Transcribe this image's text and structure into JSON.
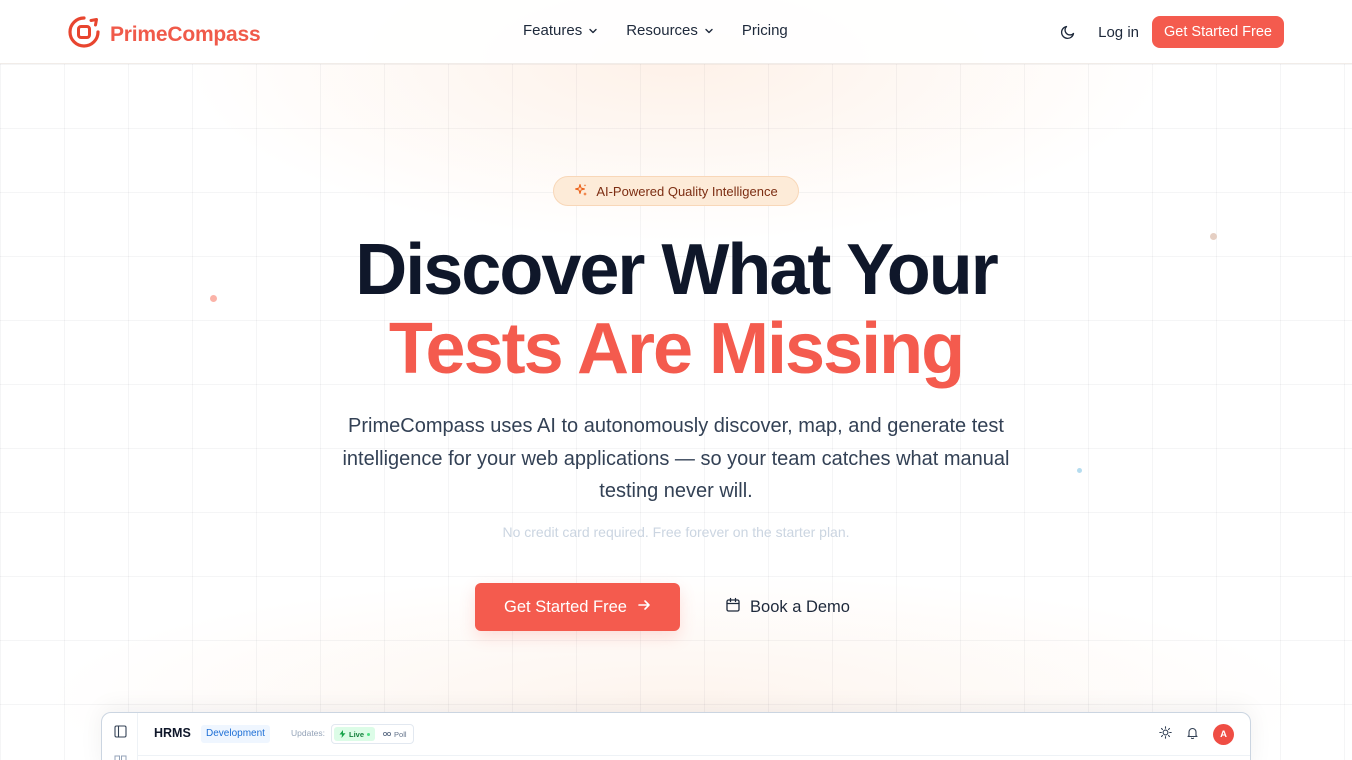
{
  "brand": {
    "name": "PrimeCompass",
    "color": "#f45b4e"
  },
  "nav": {
    "items": [
      {
        "label": "Features",
        "has_dropdown": true
      },
      {
        "label": "Resources",
        "has_dropdown": true
      },
      {
        "label": "Pricing",
        "has_dropdown": false
      }
    ],
    "theme_icon": "moon-icon",
    "login_label": "Log in",
    "cta_label": "Get Started Free"
  },
  "hero": {
    "badge": "AI-Powered Quality Intelligence",
    "headline_line1": "Discover What Your",
    "headline_line2": "Tests Are Missing",
    "subtext": "PrimeCompass uses AI to autonomously discover, map, and generate test intelligence for your web applications — so your team catches what manual testing never will.",
    "note": "No credit card required. Free forever on the starter plan.",
    "primary_cta": "Get Started Free",
    "secondary_cta": "Book a Demo"
  },
  "preview": {
    "app_name": "HRMS",
    "environment": "Development",
    "updates_label": "Updates:",
    "live_label": "Live",
    "poll_label": "Poll",
    "avatar_initial": "A"
  },
  "colors": {
    "accent": "#f45b4e",
    "headline_dark": "#0f172a",
    "badge_bg": "#fdebd8"
  }
}
